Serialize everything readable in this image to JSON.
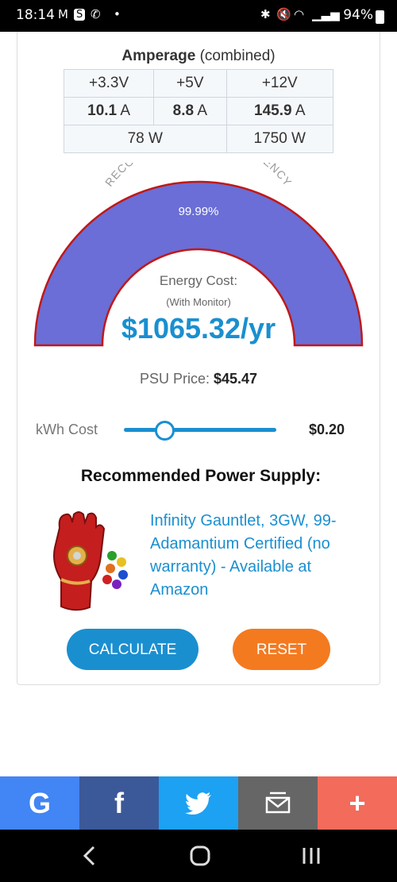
{
  "status_bar": {
    "time": "18:14",
    "battery": "94%"
  },
  "amperage": {
    "title_bold": "Amperage",
    "title_rest": "(combined)",
    "headers": [
      "+3.3V",
      "+5V",
      "+12V"
    ],
    "values": [
      {
        "num": "10.1",
        "unit": "A"
      },
      {
        "num": "8.8",
        "unit": "A"
      },
      {
        "num": "145.9",
        "unit": "A"
      }
    ],
    "watts_small": "78 W",
    "watts_12v": "1750 W"
  },
  "gauge": {
    "arc_label": "RECOMMENDED PSU EFFICIENCY",
    "efficiency": "99.99%",
    "efficiency_fraction": 0.9999,
    "fill_color": "#6a6ed6",
    "border_color": "#c01818"
  },
  "energy": {
    "label": "Energy Cost:",
    "sublabel": "(With Monitor)",
    "value": "$1065.32/yr"
  },
  "psu_price": {
    "label": "PSU Price:",
    "value": "$45.47"
  },
  "kwh": {
    "label": "kWh Cost",
    "value": "$0.20",
    "slider_fraction": 0.27
  },
  "recommendation": {
    "title": "Recommended Power Supply:",
    "product": "Infinity Gauntlet, 3GW, 99-Adamantium Certified (no warranty) - Available at Amazon"
  },
  "buttons": {
    "calculate": "CALCULATE",
    "reset": "RESET"
  },
  "share": {
    "google": "G",
    "facebook": "f",
    "plus": "+"
  },
  "colors": {
    "accent": "#1a8fd0",
    "reset": "#f47a20"
  }
}
